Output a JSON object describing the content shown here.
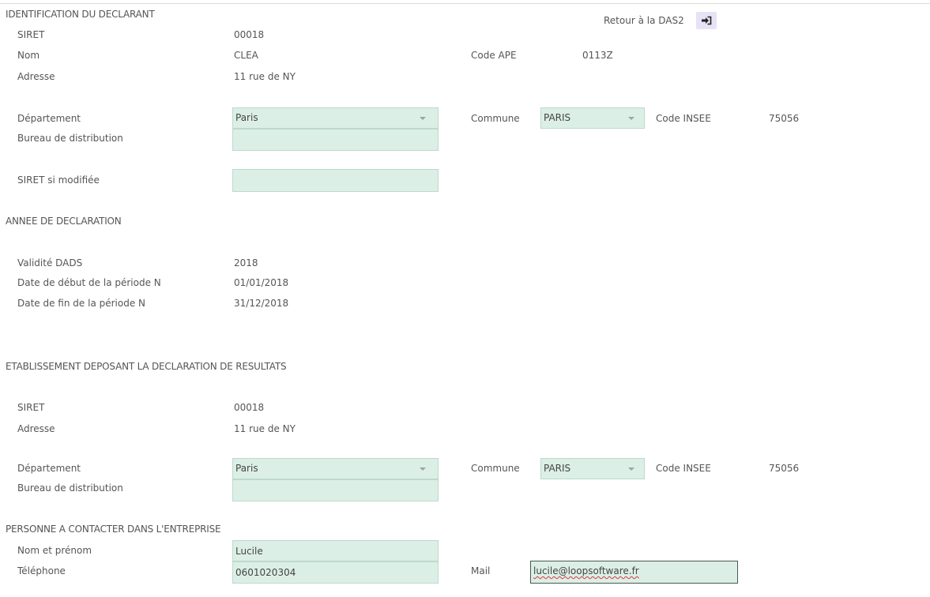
{
  "declarant": {
    "section_title": "IDENTIFICATION DU DECLARANT",
    "back_link_label": "Retour à la DAS2",
    "back_icon": "sign-in-arrow-icon",
    "siret_label": "SIRET",
    "siret_value": "00018",
    "nom_label": "Nom",
    "nom_value": "CLEA",
    "code_ape_label": "Code APE",
    "code_ape_value": "0113Z",
    "adresse_label": "Adresse",
    "adresse_value": "11 rue de NY",
    "departement_label": "Département",
    "departement_value": "Paris",
    "commune_label": "Commune",
    "commune_value": "PARIS",
    "code_insee_label": "Code INSEE",
    "code_insee_value": "75056",
    "bureau_label": "Bureau de distribution",
    "bureau_value": "",
    "siret_modifiee_label": "SIRET si modifiée",
    "siret_modifiee_value": ""
  },
  "annee": {
    "section_title": "ANNEE DE DECLARATION",
    "validite_label": "Validité DADS",
    "validite_value": "2018",
    "debut_label": "Date de début de la période N",
    "debut_value": "01/01/2018",
    "fin_label": "Date de fin de la période N",
    "fin_value": "31/12/2018"
  },
  "etablissement": {
    "section_title": "ETABLISSEMENT DEPOSANT LA DECLARATION DE RESULTATS",
    "siret_label": "SIRET",
    "siret_value": "00018",
    "adresse_label": "Adresse",
    "adresse_value": "11 rue de NY",
    "departement_label": "Département",
    "departement_value": "Paris",
    "commune_label": "Commune",
    "commune_value": "PARIS",
    "code_insee_label": "Code INSEE",
    "code_insee_value": "75056",
    "bureau_label": "Bureau de distribution",
    "bureau_value": ""
  },
  "contact": {
    "section_title": "PERSONNE A CONTACTER DANS L'ENTREPRISE",
    "nom_label": "Nom et prénom",
    "nom_value": "Lucile",
    "telephone_label": "Téléphone",
    "telephone_value": "0601020304",
    "mail_label": "Mail",
    "mail_value": "lucile@loopsoftware.fr"
  },
  "colors": {
    "field_background": "#dcefe6",
    "field_border": "#bcd9cc",
    "back_button_background": "#e7e2f5",
    "spellcheck_underline": "#d83b3b"
  }
}
